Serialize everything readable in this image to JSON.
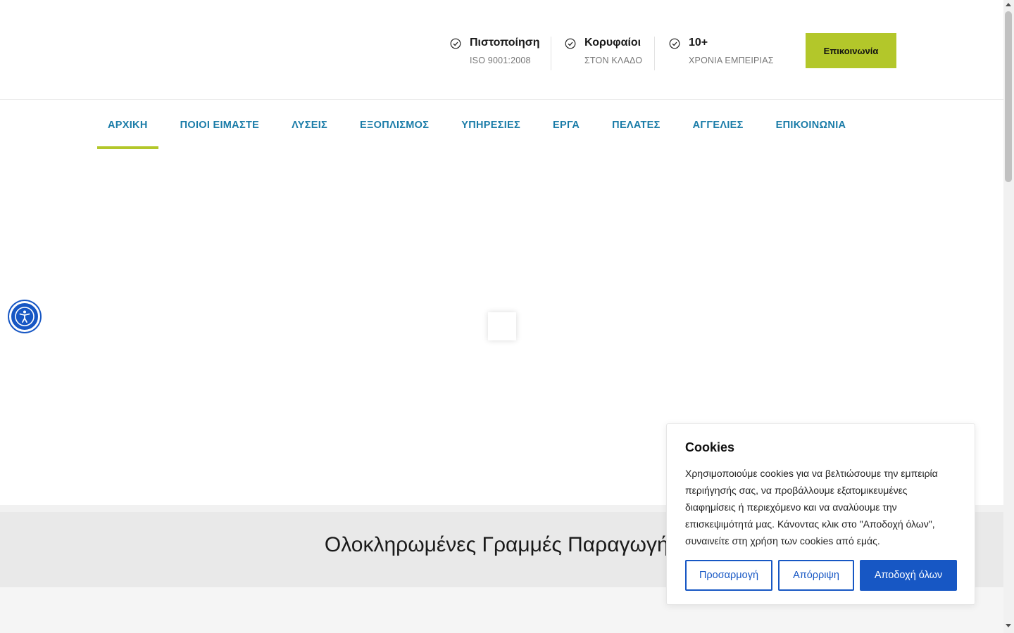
{
  "header": {
    "stats": [
      {
        "title": "Πιστοποίηση",
        "subtitle": "ISO 9001:2008"
      },
      {
        "title": "Κορυφαίοι",
        "subtitle": "ΣΤΟΝ ΚΛΑΔΟ"
      },
      {
        "title": "10+",
        "subtitle": "ΧΡΟΝΙΑ ΕΜΠΕΙΡΙΑΣ"
      }
    ],
    "contact_button": "Επικοινωνία",
    "stat_icon": "check-circle-icon"
  },
  "nav": {
    "items": [
      {
        "label": "ΑΡΧΙΚΗ",
        "active": true
      },
      {
        "label": "ΠΟΙΟΙ ΕΙΜΑΣΤΕ"
      },
      {
        "label": "ΛΥΣΕΙΣ"
      },
      {
        "label": "ΕΞΟΠΛΙΣΜΟΣ"
      },
      {
        "label": "ΥΠΗΡΕΣΙΕΣ"
      },
      {
        "label": "ΕΡΓΑ"
      },
      {
        "label": "ΠΕΛΑΤΕΣ"
      },
      {
        "label": "ΑΓΓΕΛΙΕΣ"
      },
      {
        "label": "ΕΠΙΚΟΙΝΩΝΙΑ"
      }
    ]
  },
  "section": {
    "title": "Ολοκληρωμένες Γραμμές Παραγωγής"
  },
  "accessibility": {
    "icon": "accessibility-icon"
  },
  "cookies": {
    "title": "Cookies",
    "text": "Χρησιμοποιούμε cookies για να βελτιώσουμε την εμπειρία περιήγησής σας, να προβάλλουμε εξατομικευμένες διαφημίσεις ή περιεχόμενο και να αναλύουμε την επισκεψιμότητά μας. Κάνοντας κλικ στο \"Αποδοχή όλων\", συναινείτε στη χρήση των cookies από εμάς.",
    "customize": "Προσαρμογή",
    "reject": "Απόρριψη",
    "accept": "Αποδοχή όλων"
  },
  "colors": {
    "accent_green": "#b3c72a",
    "nav_blue": "#1a7ca8",
    "cookie_blue": "#1757c4"
  }
}
